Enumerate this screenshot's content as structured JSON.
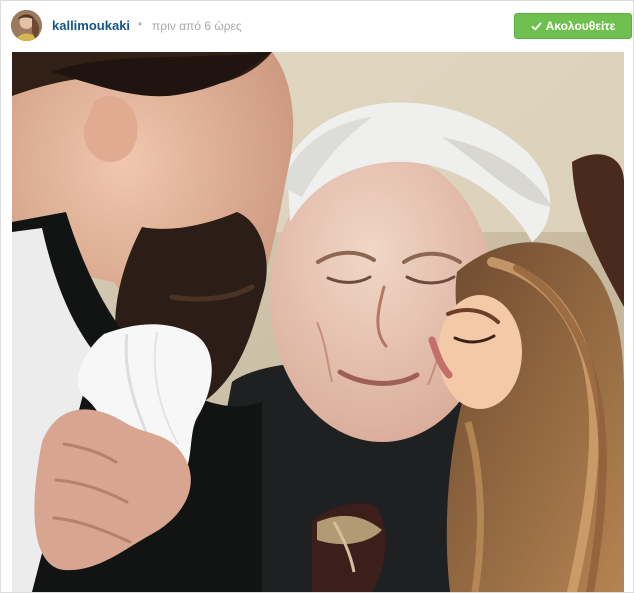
{
  "post": {
    "username": "kallimoukaki",
    "separator": "•",
    "time": "πριν από 6 ώρες",
    "follow_label": "Ακολουθείτε"
  },
  "icons": {
    "avatar": "user-avatar",
    "follow": "checkmark-icon"
  },
  "colors": {
    "username": "#125688",
    "time": "#a5a7aa",
    "follow_bg": "#70c050",
    "follow_text": "#ffffff"
  }
}
